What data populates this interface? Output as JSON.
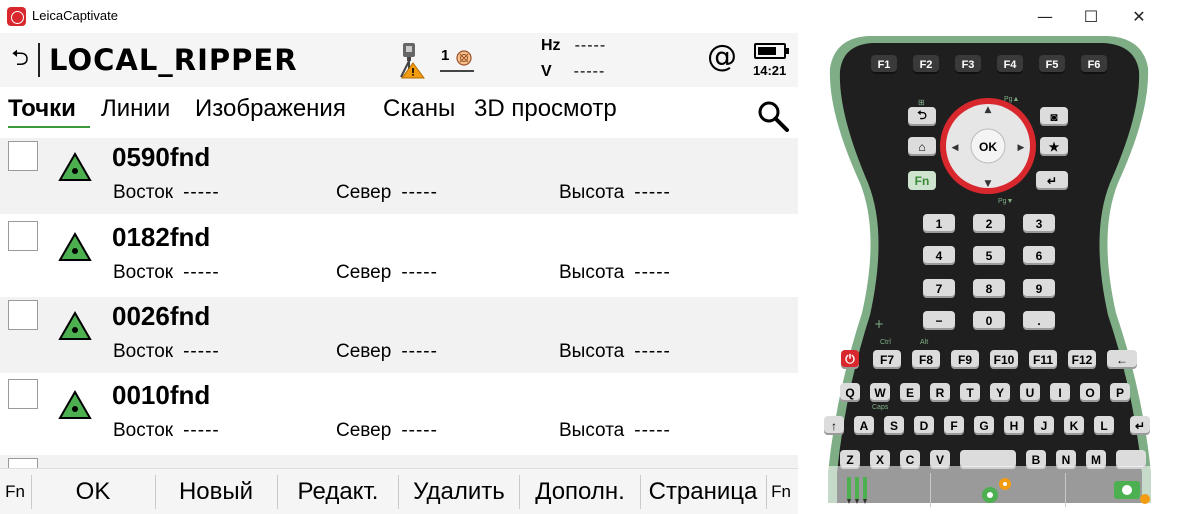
{
  "window": {
    "title": "LeicaCaptivate",
    "minimize_glyph": "—",
    "maximize_glyph": "☐",
    "close_glyph": "✕"
  },
  "header": {
    "back_glyph": "⮌",
    "job_name": "LOCAL_RIPPER",
    "prism_number": "1",
    "hz_label": "Hz",
    "hz_value": "-----",
    "v_label": "V",
    "v_value": "-----",
    "at_glyph": "@",
    "time": "14:21",
    "battery_level": 0.75
  },
  "tabs": [
    {
      "label": "Точки",
      "active": true
    },
    {
      "label": "Линии",
      "active": false
    },
    {
      "label": "Изображения",
      "active": false
    },
    {
      "label": "Сканы",
      "active": false
    },
    {
      "label": "3D просмотр",
      "active": false
    }
  ],
  "points": [
    {
      "name": "0590fnd",
      "east_label": "Восток",
      "east": "-----",
      "north_label": "Север",
      "north": "-----",
      "height_label": "Высота",
      "height": "-----"
    },
    {
      "name": "0182fnd",
      "east_label": "Восток",
      "east": "-----",
      "north_label": "Север",
      "north": "-----",
      "height_label": "Высота",
      "height": "-----"
    },
    {
      "name": "0026fnd",
      "east_label": "Восток",
      "east": "-----",
      "north_label": "Север",
      "north": "-----",
      "height_label": "Высота",
      "height": "-----"
    },
    {
      "name": "0010fnd",
      "east_label": "Восток",
      "east": "-----",
      "north_label": "Север",
      "north": "-----",
      "height_label": "Высота",
      "height": "-----"
    }
  ],
  "footer": {
    "fn_left": "Fn",
    "ok": "OK",
    "new": "Новый",
    "edit": "Редакт.",
    "delete": "Удалить",
    "more": "Дополн.",
    "page": "Страница",
    "fn_right": "Fn"
  },
  "keypad": {
    "function_keys": [
      "F1",
      "F2",
      "F3",
      "F4",
      "F5",
      "F6"
    ],
    "ok_label": "OK",
    "fn_label": "Fn",
    "numpad": [
      "1",
      "2",
      "3",
      "4",
      "5",
      "6",
      "7",
      "8",
      "9",
      "−",
      "0",
      "."
    ],
    "f_row2": [
      "F7",
      "F8",
      "F9",
      "F10",
      "F11",
      "F12"
    ],
    "ctrl_label": "Ctrl",
    "alt_label": "Alt",
    "caps_label": "Caps",
    "row_q": [
      "Q",
      "W",
      "E",
      "R",
      "T",
      "Y",
      "U",
      "I",
      "O",
      "P"
    ],
    "row_a": [
      "A",
      "S",
      "D",
      "F",
      "G",
      "H",
      "J",
      "K",
      "L"
    ],
    "row_z": [
      "Z",
      "X",
      "C",
      "V",
      "B",
      "N",
      "M"
    ],
    "pg_up": "Pg▲",
    "pg_down": "Pg▼",
    "colors": {
      "body": "#1f1f1f",
      "rim": "#7fae86",
      "ring": "#d9272e",
      "accent_green": "#4caf50",
      "accent_orange": "#f39c12"
    }
  }
}
